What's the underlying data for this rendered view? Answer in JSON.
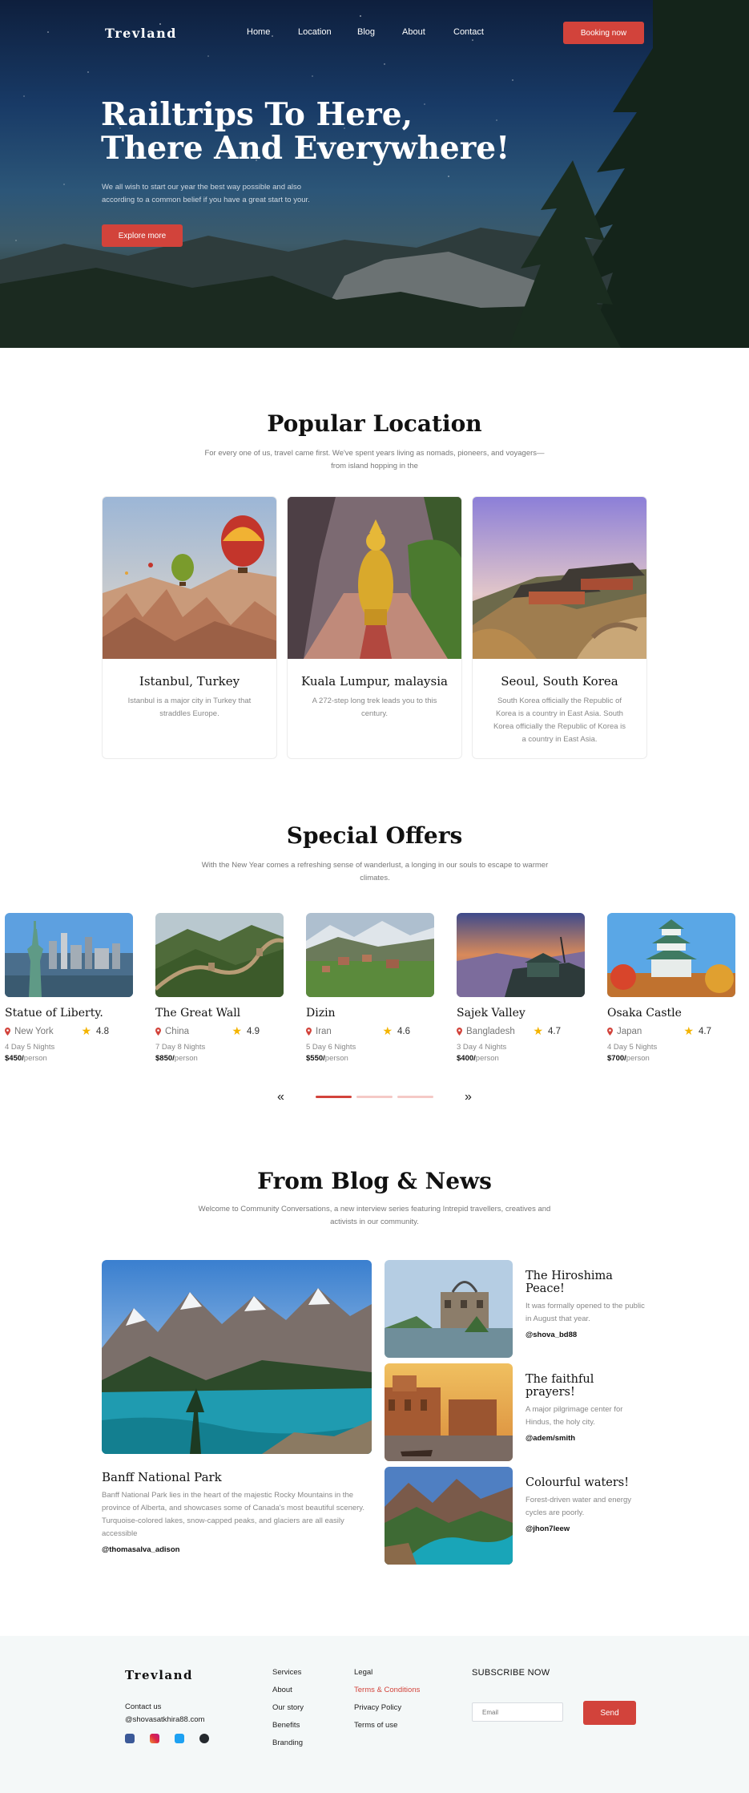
{
  "brand": "Trevland",
  "nav": {
    "links": [
      "Home",
      "Location",
      "Blog",
      "About",
      "Contact"
    ],
    "booking_label": "Booking now"
  },
  "hero": {
    "title_line1": "Railtrips To Here,",
    "title_line2": "There And Everywhere!",
    "subtitle": "We all wish to start our year the best way possible and also according to a common belief if you have a great start to your.",
    "cta": "Explore more"
  },
  "popular": {
    "title": "Popular Location",
    "subtitle": "For every one of us, travel came first. We've spent years living as nomads, pioneers, and voyagers—from island hopping in the",
    "cards": [
      {
        "name": "Istanbul, Turkey",
        "desc": "Istanbul is a major city in Turkey that straddles Europe."
      },
      {
        "name": "Kuala Lumpur, malaysia",
        "desc": "A 272-step long trek leads you to this century."
      },
      {
        "name": "Seoul, South Korea",
        "desc": "South Korea officially the Republic of Korea is a country in East Asia. South Korea officially the Republic of Korea is a country in East Asia."
      }
    ]
  },
  "offers": {
    "title": "Special Offers",
    "subtitle": "With the New Year comes a refreshing sense of wanderlust, a longing in our souls to escape to warmer climates.",
    "items": [
      {
        "name": "Statue of Liberty.",
        "location": "New York",
        "rating": "4.8",
        "duration": "4 Day 5 Nights",
        "price": "$450/",
        "unit": "person"
      },
      {
        "name": "The Great Wall",
        "location": "China",
        "rating": "4.9",
        "duration": "7 Day 8 Nights",
        "price": "$850/",
        "unit": "person"
      },
      {
        "name": "Dizin",
        "location": "Iran",
        "rating": "4.6",
        "duration": "5 Day 6 Nights",
        "price": "$550/",
        "unit": "person"
      },
      {
        "name": "Sajek Valley",
        "location": "Bangladesh",
        "rating": "4.7",
        "duration": "3 Day 4 Nights",
        "price": "$400/",
        "unit": "person"
      },
      {
        "name": "Osaka Castle",
        "location": "Japan",
        "rating": "4.7",
        "duration": "4 Day 5 Nights",
        "price": "$700/",
        "unit": "person"
      }
    ],
    "prev": "«",
    "next": "»"
  },
  "blog": {
    "title": "From Blog & News",
    "subtitle": "Welcome to Community Conversations, a new interview series featuring Intrepid travellers, creatives and activists in our community.",
    "main": {
      "title": "Banff National Park",
      "desc": "Banff National Park lies in the heart of the majestic Rocky Mountains in the province of Alberta, and showcases some of Canada's most beautiful scenery. Turquoise-colored lakes, snow-capped peaks, and glaciers are all easily accessible",
      "author": "@thomasalva_adison"
    },
    "posts": [
      {
        "title": "The Hiroshima Peace!",
        "desc": "It was formally opened to the public in August that year.",
        "author": "@shova_bd88"
      },
      {
        "title": "The faithful prayers!",
        "desc": "A major pilgrimage center for Hindus, the holy city.",
        "author": "@adem/smith"
      },
      {
        "title": "Colourful waters!",
        "desc": "Forest-driven water and energy cycles are poorly.",
        "author": "@jhon7leew"
      }
    ]
  },
  "footer": {
    "brand": "Trevland",
    "contact_label": "Contact us",
    "email": "@shovasatkhira88.com",
    "col1": [
      "Services",
      "About",
      "Our story",
      "Benefits",
      "Branding"
    ],
    "col2": [
      "Legal",
      "Terms & Conditions",
      "Privacy Policy",
      "Terms of use"
    ],
    "subscribe_title": "SUBSCRIBE NOW",
    "email_placeholder": "Email",
    "send_label": "Send"
  },
  "colors": {
    "accent": "#d2433b",
    "star": "#f4b400"
  }
}
